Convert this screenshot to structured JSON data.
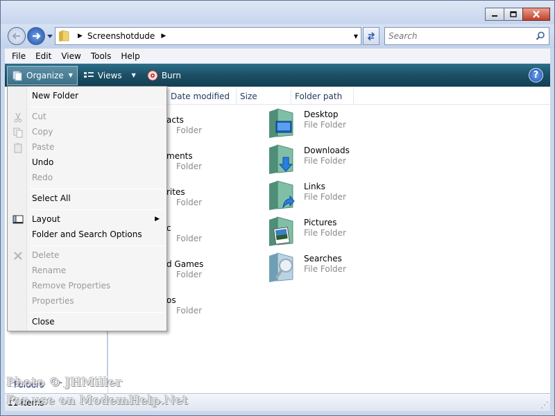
{
  "window": {
    "title_buttons": [
      "minimize",
      "maximize",
      "close"
    ]
  },
  "address": {
    "crumb": "Screenshotdude",
    "search_placeholder": "Search"
  },
  "menubar": [
    "File",
    "Edit",
    "View",
    "Tools",
    "Help"
  ],
  "commandbar": {
    "organize": "Organize",
    "views": "Views",
    "burn": "Burn",
    "help": "?"
  },
  "columns": [
    "Date modified",
    "Size",
    "Folder path"
  ],
  "items_left": [
    {
      "name": "acts",
      "type": "Folder"
    },
    {
      "name": "ments",
      "type": "Folder"
    },
    {
      "name": "rites",
      "type": "Folder"
    },
    {
      "name": "c",
      "type": "Folder"
    },
    {
      "name": "d Games",
      "type": "Folder"
    },
    {
      "name": "os",
      "type": "Folder"
    }
  ],
  "items_right": [
    {
      "name": "Desktop",
      "type": "File Folder",
      "icon": "desktop-folder-icon"
    },
    {
      "name": "Downloads",
      "type": "File Folder",
      "icon": "downloads-folder-icon"
    },
    {
      "name": "Links",
      "type": "File Folder",
      "icon": "links-folder-icon"
    },
    {
      "name": "Pictures",
      "type": "File Folder",
      "icon": "pictures-folder-icon"
    },
    {
      "name": "Searches",
      "type": "File Folder",
      "icon": "searches-folder-icon"
    }
  ],
  "nav": {
    "folders": "Folders"
  },
  "status": {
    "count": "11 items"
  },
  "watermark": {
    "line1": "Photo © JHMiller",
    "line2": "For use on ModemHelp.Net"
  },
  "menu": {
    "new_folder": "New Folder",
    "cut": "Cut",
    "copy": "Copy",
    "paste": "Paste",
    "undo": "Undo",
    "redo": "Redo",
    "select_all": "Select All",
    "layout": "Layout",
    "folder_options": "Folder and Search Options",
    "delete": "Delete",
    "rename": "Rename",
    "remove_properties": "Remove Properties",
    "properties": "Properties",
    "close": "Close"
  },
  "colors": {
    "command_bar": "#1c4f65",
    "accent_blue": "#1d4fb3",
    "disabled_text": "#9a9a9a"
  }
}
